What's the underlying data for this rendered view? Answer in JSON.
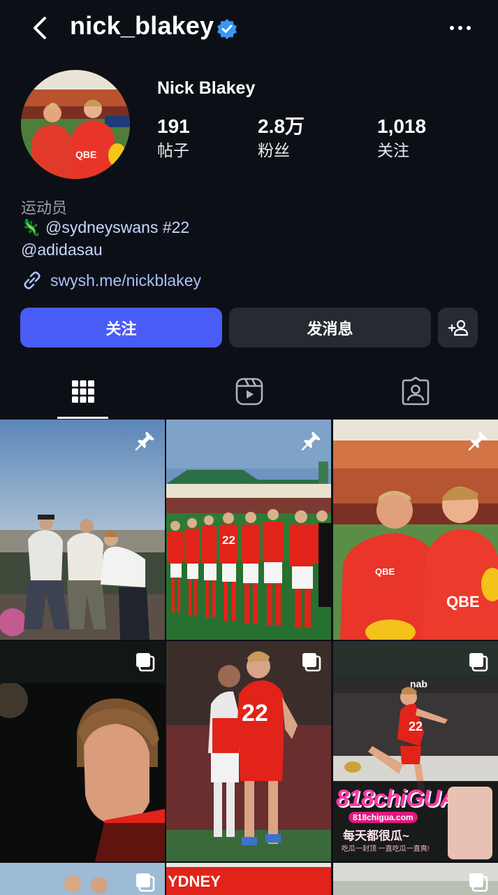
{
  "profile": {
    "username": "nick_blakey",
    "full_name": "Nick Blakey",
    "stats": [
      {
        "value": "191",
        "label": "帖子"
      },
      {
        "value": "2.8万",
        "label": "粉丝"
      },
      {
        "value": "1,018",
        "label": "关注"
      }
    ],
    "bio_category": "运动员",
    "bio_line1": "🦎 @sydneyswans #22",
    "bio_line2": "@adidasau",
    "link": "swysh.me/nickblakey"
  },
  "actions": {
    "follow": "关注",
    "message": "发消息"
  },
  "tabs": [
    {
      "name": "posts",
      "icon": "grid-icon",
      "selected": true
    },
    {
      "name": "reels",
      "icon": "reels-icon",
      "selected": false
    },
    {
      "name": "tagged",
      "icon": "tagged-person-icon",
      "selected": false
    }
  ],
  "posts": [
    {
      "id": 1,
      "badge": "pin-icon"
    },
    {
      "id": 2,
      "badge": "pin-icon"
    },
    {
      "id": 3,
      "badge": "pin-icon"
    },
    {
      "id": 4,
      "badge": "carousel-icon"
    },
    {
      "id": 5,
      "badge": "carousel-icon"
    },
    {
      "id": 6,
      "badge": "carousel-icon"
    },
    {
      "id": 7,
      "badge": "carousel-icon"
    },
    {
      "id": 8,
      "badge": ""
    },
    {
      "id": 9,
      "badge": "carousel-icon"
    }
  ],
  "overlay_ad": {
    "brand": "818chiGUA",
    "site": "818chigua.com",
    "slogan": "每天都很瓜~",
    "tagline": "吃瓜一封顶 一直吃瓜一直爽!"
  },
  "visible_signage": {
    "tile2_sign": "22",
    "tile5_jersey": "22",
    "tile6_jersey": "22",
    "tile6_sponsor": "nab",
    "tile8_sign": "YDNEY",
    "tile3_sponsor": "QBE"
  },
  "colors": {
    "background": "#0c1016",
    "follow_button": "#4a5cf6",
    "secondary_button": "#262b33",
    "link": "#a9bfff",
    "verified": "#3897f0",
    "swans_red": "#e2231a"
  }
}
